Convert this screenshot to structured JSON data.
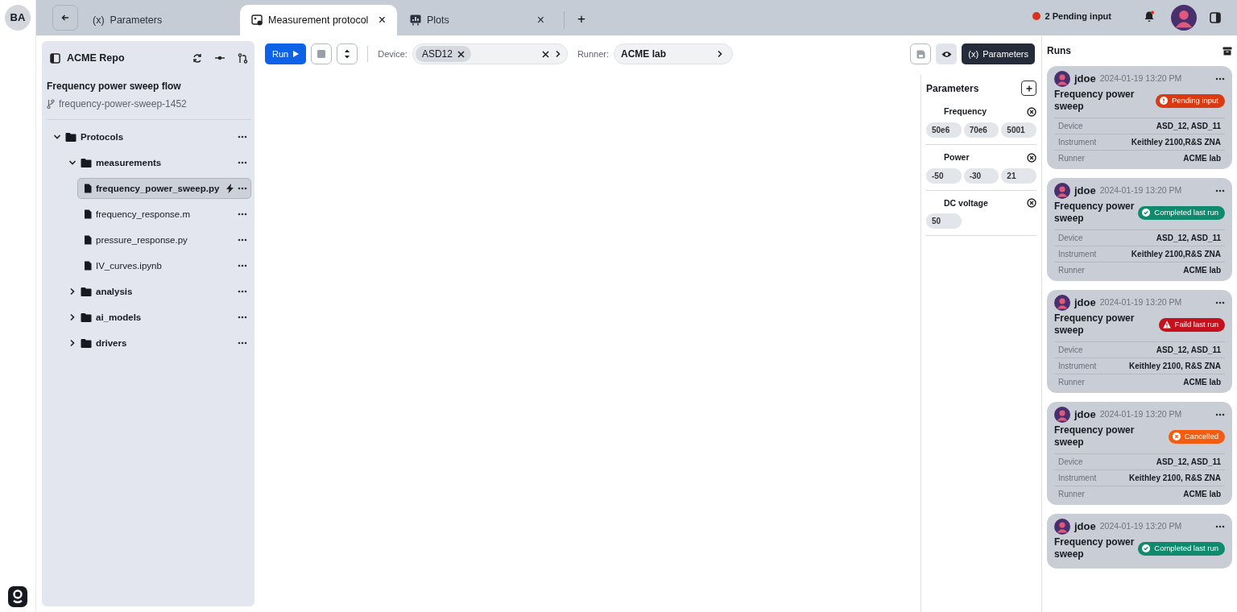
{
  "rail": {
    "avatar": "BA"
  },
  "tabs": [
    {
      "label": "Parameters",
      "icon": "(x)",
      "kind": "params",
      "selected": false
    },
    {
      "label": "Measurement protocol",
      "kind": "protocol",
      "selected": true,
      "close": "×"
    },
    {
      "label": "Plots",
      "kind": "plots",
      "selected": false,
      "close": "×"
    }
  ],
  "new_tab": "+",
  "pending": {
    "label": "2 Pending input"
  },
  "sidebar": {
    "repo": "ACME Repo",
    "flow": "Frequency power sweep flow",
    "branch": "frequency-power-sweep-1452",
    "tree": [
      {
        "label": "Protocols",
        "kind": "folder",
        "expanded": true,
        "selected": false,
        "children": [
          {
            "label": "measurements",
            "kind": "folder",
            "expanded": true,
            "selected": false,
            "children": [
              {
                "label": "frequency_power_sweep.py",
                "kind": "file",
                "selected": true
              },
              {
                "label": "frequency_response.m",
                "kind": "file",
                "selected": false
              },
              {
                "label": "pressure_response.py",
                "kind": "file",
                "selected": false
              },
              {
                "label": "IV_curves.ipynb",
                "kind": "file",
                "selected": false
              }
            ]
          },
          {
            "label": "analysis",
            "kind": "folder",
            "expanded": false,
            "selected": false
          },
          {
            "label": "ai_models",
            "kind": "folder",
            "expanded": false,
            "selected": false
          },
          {
            "label": "drivers",
            "kind": "folder",
            "expanded": false,
            "selected": false
          }
        ]
      }
    ]
  },
  "toolbar": {
    "run": "Run",
    "device_label": "Device:",
    "device_chips": [
      "ASD12"
    ],
    "runner_label": "Runner:",
    "runner": "ACME lab",
    "params_icon": "(x)",
    "params_button": "Parameters"
  },
  "parameters": {
    "title": "Parameters",
    "groups": [
      {
        "name": "Frequency",
        "values": [
          "50e6",
          "70e6",
          "5001"
        ]
      },
      {
        "name": "Power",
        "values": [
          "-50",
          "-30",
          "21"
        ]
      },
      {
        "name": "DC voltage",
        "values": [
          "50"
        ]
      }
    ]
  },
  "runs": {
    "title": "Runs",
    "cards": [
      {
        "user": "jdoe",
        "time": "2024-01-19 13:20 PM",
        "title": "Frequency power sweep",
        "kind": "pending",
        "status_label": "Pending input",
        "rows": [
          {
            "label": "Device",
            "value": "ASD_12, ASD_11"
          },
          {
            "label": "Instrument",
            "value": "Keithley 2100,R&S ZNA"
          },
          {
            "label": "Runner",
            "value": "ACME lab"
          }
        ]
      },
      {
        "user": "jdoe",
        "time": "2024-01-19 13:20 PM",
        "title": "Frequency power sweep",
        "kind": "completed",
        "status_label": "Completed last run",
        "rows": [
          {
            "label": "Device",
            "value": "ASD_12, ASD_11"
          },
          {
            "label": "Instrument",
            "value": "Keithley 2100,R&S ZNA"
          },
          {
            "label": "Runner",
            "value": "ACME lab"
          }
        ]
      },
      {
        "user": "jdoe",
        "time": "2024-01-19 13:20 PM",
        "title": "Frequency power sweep",
        "kind": "failed",
        "status_label": "Faild last run",
        "rows": [
          {
            "label": "Device",
            "value": "ASD_12, ASD_11"
          },
          {
            "label": "Instrument",
            "value": "Keithley 2100, R&S ZNA"
          },
          {
            "label": "Runner",
            "value": "ACME lab"
          }
        ]
      },
      {
        "user": "jdoe",
        "time": "2024-01-19 13:20 PM",
        "title": "Frequency power sweep",
        "kind": "cancelled",
        "status_label": "Cancelled",
        "rows": [
          {
            "label": "Device",
            "value": "ASD_12, ASD_11"
          },
          {
            "label": "Instrument",
            "value": "Keithley 2100, R&S ZNA"
          },
          {
            "label": "Runner",
            "value": "ACME lab"
          }
        ]
      },
      {
        "user": "jdoe",
        "time": "2024-01-19 13:20 PM",
        "title": "Frequency power sweep",
        "kind": "completed",
        "status_label": "Completed last run"
      }
    ]
  }
}
